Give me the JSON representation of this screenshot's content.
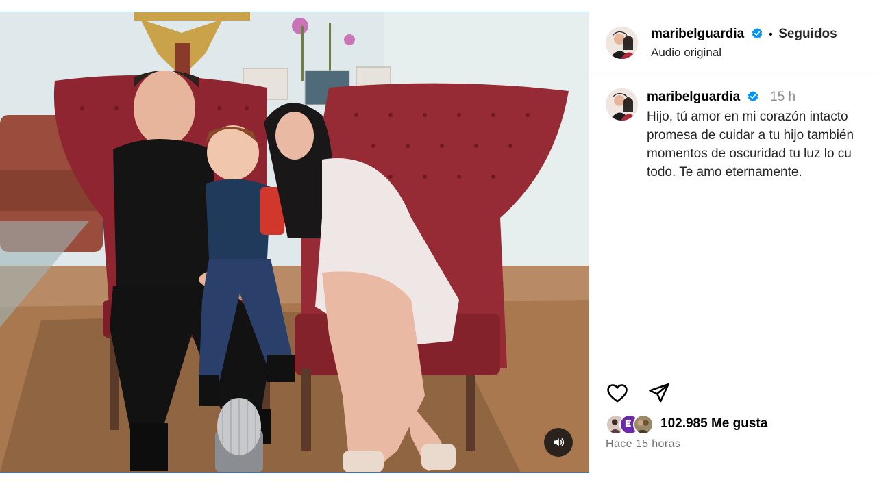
{
  "media": {
    "sound_icon": "speaker-icon"
  },
  "post": {
    "username": "maribelguardia",
    "verified_icon": "verified-badge-icon",
    "separator": "•",
    "follow_status": "Seguidos",
    "audio_label": "Audio original",
    "caption_time": "15 h",
    "caption_lines": [
      "Hijo, tú amor en mi corazón intacto",
      "promesa de cuidar a tu hijo también",
      "momentos de oscuridad tu luz lo cu",
      "todo. Te amo eternamente."
    ],
    "likes_text": "102.985 Me gusta",
    "posted_ago": "Hace 15 horas"
  },
  "actions": {
    "like_icon": "heart-icon",
    "share_icon": "paper-plane-icon"
  },
  "colors": {
    "verified_blue": "#0095f6",
    "chair_red": "#8e2530",
    "border_blue": "#3b6fd8",
    "muted_gray": "#8e8e8e"
  }
}
